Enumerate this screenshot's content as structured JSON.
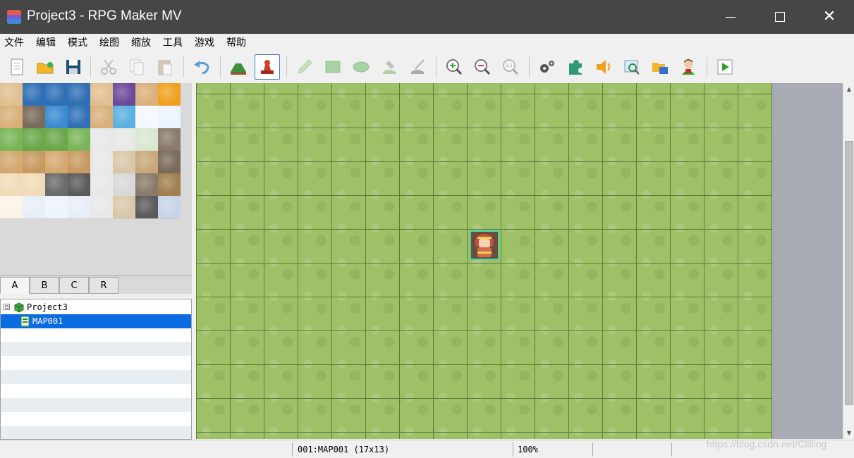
{
  "window": {
    "title": "Project3 - RPG Maker MV",
    "minimize_glyph": "",
    "maximize_glyph": "",
    "close_glyph": "✕"
  },
  "menu": [
    "文件",
    "编辑",
    "模式",
    "绘图",
    "缩放",
    "工具",
    "游戏",
    "帮助"
  ],
  "toolbar": {
    "buttons": [
      "new-project",
      "open-project",
      "save-project",
      "cut",
      "copy",
      "paste",
      "undo",
      "map-mode",
      "event-mode",
      "pencil",
      "rectangle",
      "ellipse",
      "flood-fill",
      "shadow-pen",
      "zoom-in",
      "zoom-out",
      "actual-size",
      "database",
      "plugin-manager",
      "sound-test",
      "event-searcher",
      "resource-manager",
      "character-generator",
      "playtest"
    ],
    "active": "event-mode",
    "zoom_actual_label": "1:1"
  },
  "tileset_tabs": [
    "A",
    "B",
    "C",
    "R"
  ],
  "tileset_active_tab": "A",
  "map_tree": {
    "project": "Project3",
    "expander": "⊟",
    "maps": [
      {
        "label": "MAP001",
        "selected": true
      }
    ]
  },
  "map": {
    "width_tiles": 17,
    "height_tiles": 13
  },
  "scrollbar": {
    "up": "▲",
    "down": "▼"
  },
  "status": {
    "map_info": "001:MAP001 (17x13)",
    "zoom": "100%"
  },
  "watermark": "https://blog.csdn.net/Clilling",
  "colors": {
    "titlebar": "#474646",
    "grass": "#9ec168",
    "grid": "#5e7a3a",
    "selection": "#0a6ce0",
    "event_border": "#4ad3b0"
  }
}
